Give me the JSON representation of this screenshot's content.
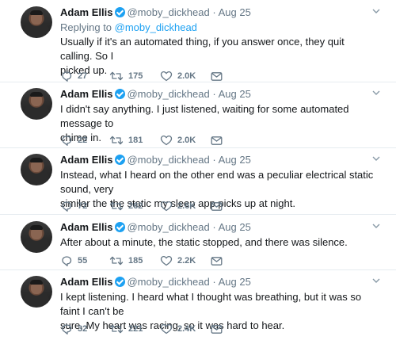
{
  "tweets": [
    {
      "name": "Adam Ellis",
      "handle": "@moby_dickhead",
      "separator": "·",
      "date": "Aug 25",
      "reply_prefix": "Replying to ",
      "reply_to": "@moby_dickhead",
      "lines": [
        "Usually if it's an automated thing, if you answer once, they quit calling. So I",
        "picked up."
      ],
      "replies": "27",
      "retweets": "175",
      "likes": "2.0K"
    },
    {
      "name": "Adam Ellis",
      "handle": "@moby_dickhead",
      "separator": "·",
      "date": "Aug 25",
      "lines": [
        "I didn't say anything. I just listened, waiting for some automated message to",
        "chime in."
      ],
      "replies": "22",
      "retweets": "181",
      "likes": "2.0K"
    },
    {
      "name": "Adam Ellis",
      "handle": "@moby_dickhead",
      "separator": "·",
      "date": "Aug 25",
      "lines": [
        "Instead, what I heard on the other end was a peculiar electrical static sound, very",
        "similar the the static my sleep app picks up at night."
      ],
      "replies": "72",
      "retweets": "262",
      "likes": "2.6K"
    },
    {
      "name": "Adam Ellis",
      "handle": "@moby_dickhead",
      "separator": "·",
      "date": "Aug 25",
      "lines": [
        "After about a minute, the static stopped, and there was silence."
      ],
      "replies": "55",
      "retweets": "185",
      "likes": "2.2K"
    },
    {
      "name": "Adam Ellis",
      "handle": "@moby_dickhead",
      "separator": "·",
      "date": "Aug 25",
      "lines": [
        "I kept listening. I heard what I thought was breathing, but it was so faint I can't be",
        "sure. My heart was racing, so it was hard to hear."
      ],
      "replies": "32",
      "retweets": "221",
      "likes": "2.4K"
    }
  ],
  "icons": {
    "reply": "reply-icon",
    "retweet": "retweet-icon",
    "like": "heart-icon",
    "message": "envelope-icon",
    "more": "chevron-down-icon",
    "verified": "verified-badge-icon"
  },
  "colors": {
    "brand": "#1da1f2",
    "muted": "#657786",
    "text": "#14171a",
    "divider": "#e6ecf0"
  }
}
